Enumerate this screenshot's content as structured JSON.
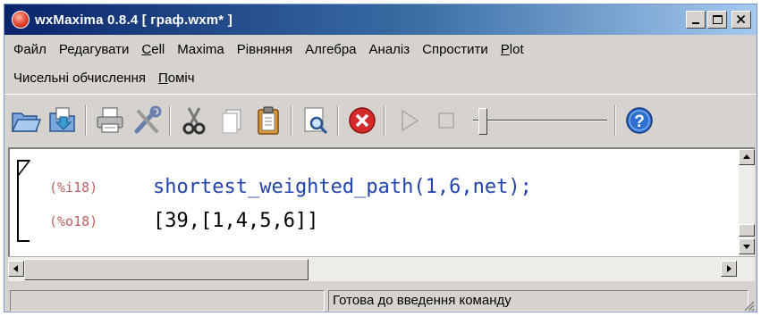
{
  "window": {
    "title": "wxMaxima 0.8.4 [ граф.wxm* ]",
    "icon": "maxima-app-icon"
  },
  "menu": {
    "row1": [
      {
        "pre": "Файл",
        "mn": "",
        "post": ""
      },
      {
        "pre": "Редагувати",
        "mn": "",
        "post": ""
      },
      {
        "pre": "",
        "mn": "C",
        "post": "ell"
      },
      {
        "pre": "Maxima",
        "mn": "",
        "post": ""
      },
      {
        "pre": "Рівняння",
        "mn": "",
        "post": ""
      },
      {
        "pre": "Алгебра",
        "mn": "",
        "post": ""
      },
      {
        "pre": "Аналіз",
        "mn": "",
        "post": ""
      },
      {
        "pre": "Спростити",
        "mn": "",
        "post": ""
      },
      {
        "pre": "",
        "mn": "P",
        "post": "lot"
      }
    ],
    "row2": [
      {
        "pre": "Чисельні обчислення",
        "mn": "",
        "post": ""
      },
      {
        "pre": "",
        "mn": "П",
        "post": "оміч"
      }
    ]
  },
  "toolbar": {
    "icons": [
      "open-folder-icon",
      "save-icon",
      "print-icon",
      "settings-tools-icon",
      "cut-icon",
      "copy-icon",
      "paste-icon",
      "find-icon",
      "interrupt-icon",
      "play-icon",
      "stop-icon",
      "animation-slider",
      "help-icon"
    ],
    "colors": {
      "interrupt": "#d42a2a",
      "help": "#2f6fd0",
      "folder": "#3a78c8"
    }
  },
  "document": {
    "input_prompt": "(%i18)",
    "input_text": "shortest_weighted_path(1,6,net);",
    "output_prompt": "(%o18)",
    "output_text": "[39,[1,4,5,6]]",
    "colors": {
      "prompt": "#c06060",
      "input": "#2244aa",
      "output": "#000000"
    }
  },
  "statusbar": {
    "left": "",
    "message": "Готова до введення команду"
  }
}
